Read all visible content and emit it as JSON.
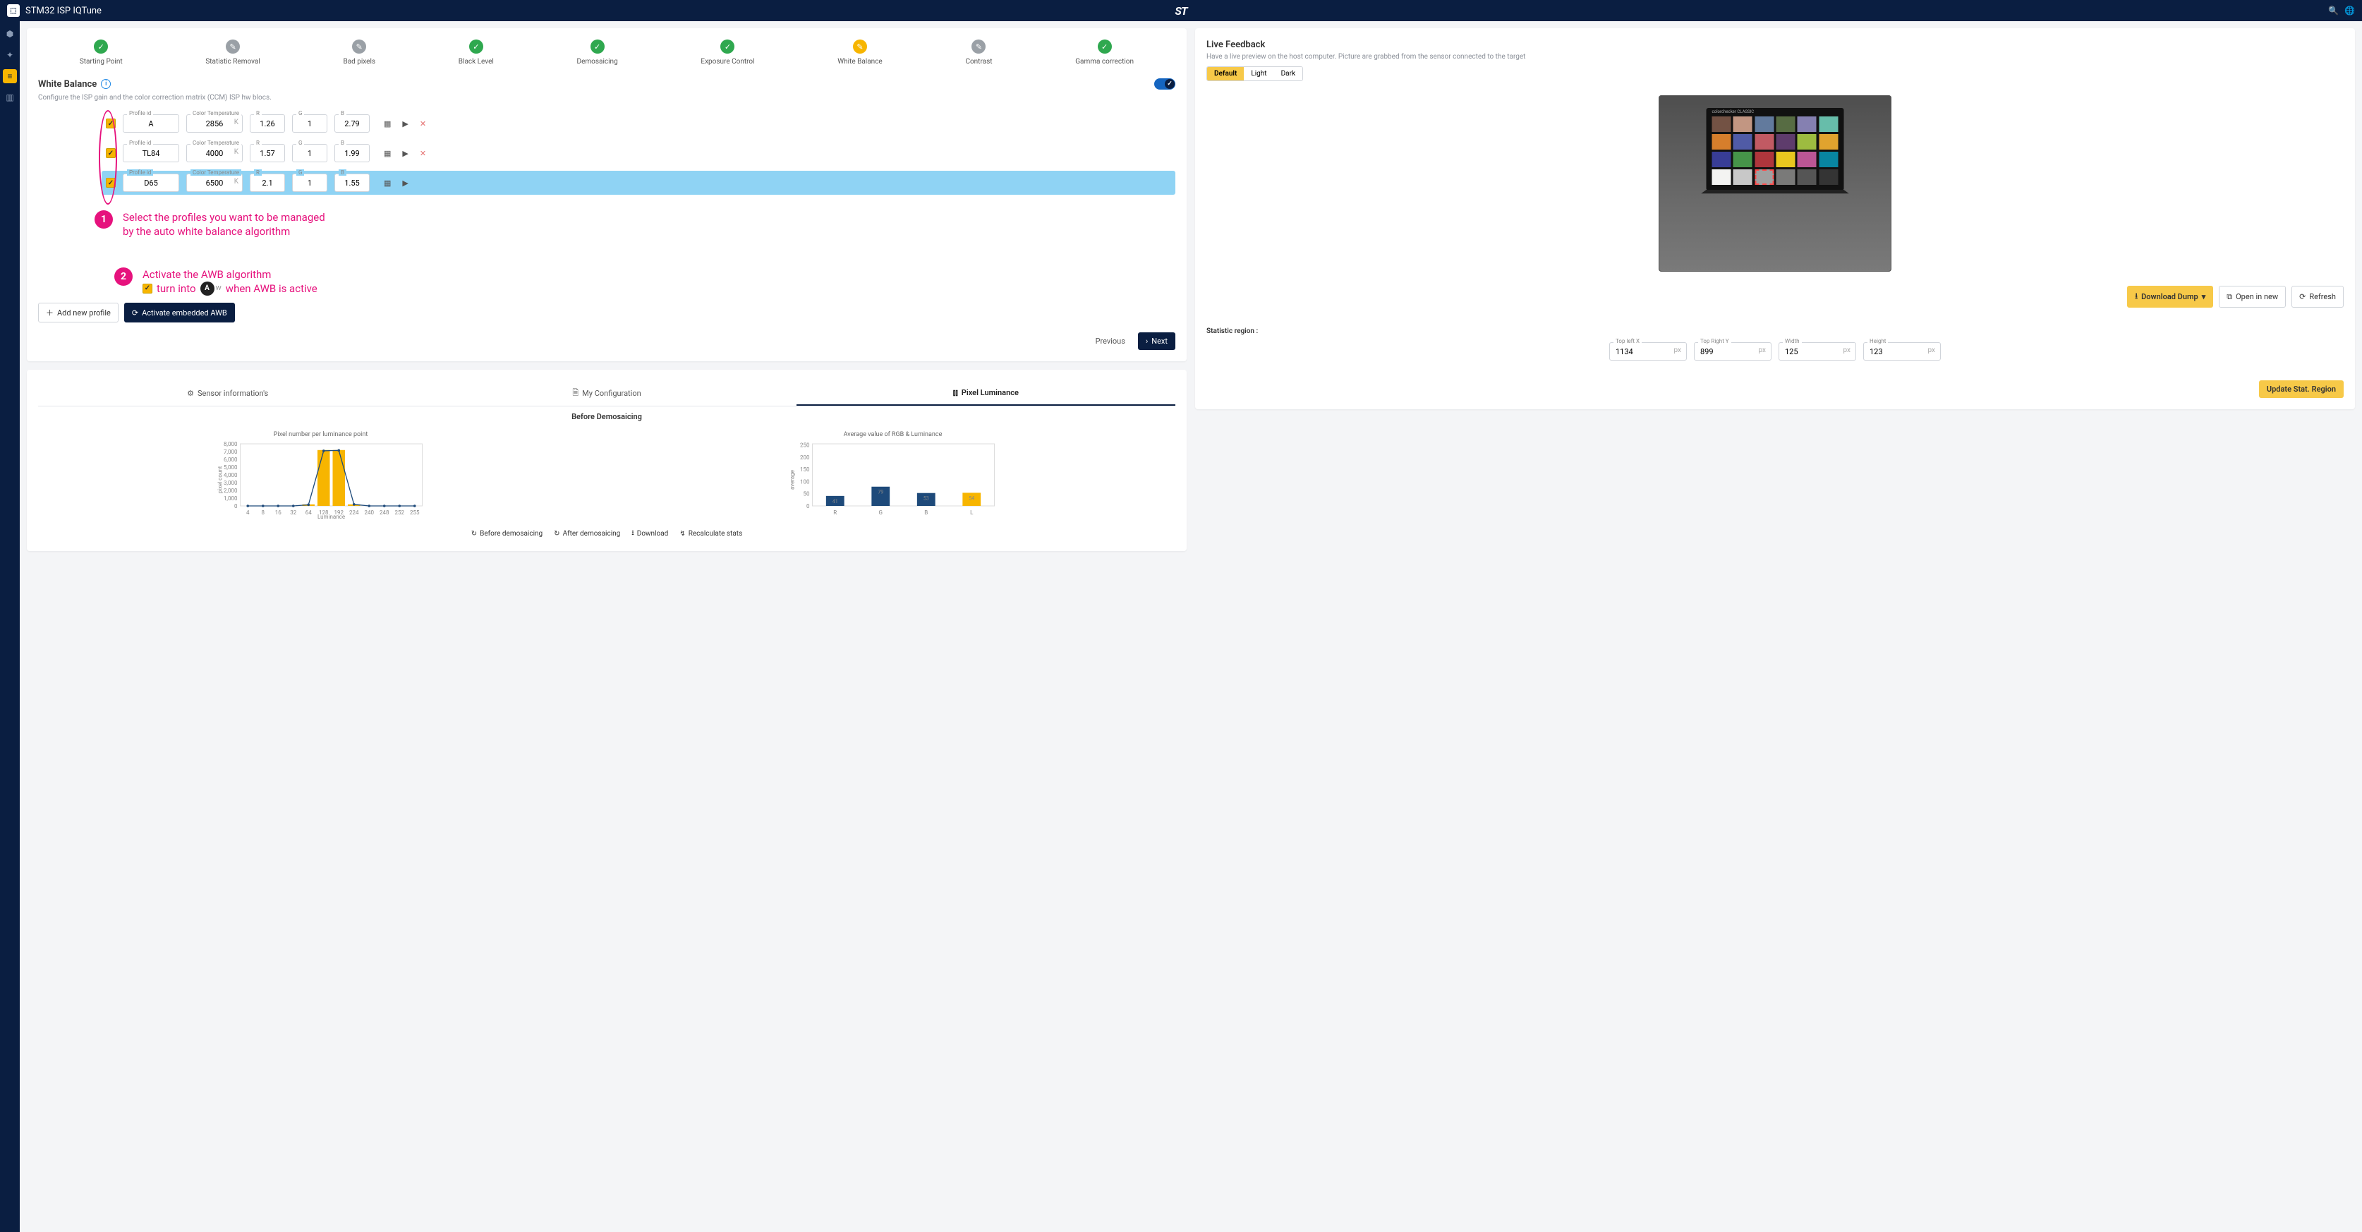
{
  "app_title": "STM32 ISP IQTune",
  "center_logo": "ST",
  "stepper": [
    {
      "label": "Starting Point",
      "state": "green",
      "glyph": "✓"
    },
    {
      "label": "Statistic Removal",
      "state": "gray",
      "glyph": "✎"
    },
    {
      "label": "Bad pixels",
      "state": "gray",
      "glyph": "✎"
    },
    {
      "label": "Black Level",
      "state": "green",
      "glyph": "✓"
    },
    {
      "label": "Demosaicing",
      "state": "green",
      "glyph": "✓"
    },
    {
      "label": "Exposure Control",
      "state": "green",
      "glyph": "✓"
    },
    {
      "label": "White Balance",
      "state": "yellow",
      "glyph": "✎"
    },
    {
      "label": "Contrast",
      "state": "gray",
      "glyph": "✎"
    },
    {
      "label": "Gamma correction",
      "state": "green",
      "glyph": "✓"
    }
  ],
  "wb": {
    "title": "White Balance",
    "subtitle": "Configure the ISP gain and the color correction matrix (CCM) ISP hw blocs.",
    "field_labels": {
      "profile": "Profile id",
      "temp": "Color Temperature",
      "r": "R",
      "g": "G",
      "b": "B"
    },
    "rows": [
      {
        "profile": "A",
        "temp": "2856",
        "r": "1.26",
        "g": "1",
        "b": "2.79",
        "deletable": true,
        "selected": false
      },
      {
        "profile": "TL84",
        "temp": "4000",
        "r": "1.57",
        "g": "1",
        "b": "1.99",
        "deletable": true,
        "selected": false
      },
      {
        "profile": "D65",
        "temp": "6500",
        "r": "2.1",
        "g": "1",
        "b": "1.55",
        "deletable": false,
        "selected": true
      }
    ],
    "add_profile": "Add new profile",
    "activate_awb": "Activate embedded AWB",
    "previous": "Previous",
    "next": "Next"
  },
  "annotations": {
    "a1": "Select the profiles you want to be managed\nby the auto white balance algorithm",
    "a2_line1": "Activate the AWB algorithm",
    "a2_prefix": "turn into",
    "a2_suffix": "when AWB is active"
  },
  "bottom_tabs": {
    "t1": "Sensor information's",
    "t2": "My Configuration",
    "t3": "Pixel Luminance"
  },
  "charts": {
    "main_title": "Before Demosaicing",
    "left_title": "Pixel number per luminance point",
    "right_title": "Average value of RGB & Luminance",
    "y_label_left": "pixel count",
    "y_label_right": "average",
    "x_label_left": "Luminance",
    "actions": {
      "before": "Before demosaicing",
      "after": "After demosaicing",
      "download": "Download",
      "recalc": "Recalculate stats"
    }
  },
  "chart_data": [
    {
      "type": "bar",
      "title": "Pixel number per luminance point",
      "xlabel": "Luminance",
      "ylabel": "pixel count",
      "ylim": [
        0,
        8000
      ],
      "categories": [
        4,
        8,
        16,
        32,
        64,
        128,
        192,
        224,
        240,
        248,
        252,
        255
      ],
      "values": [
        0,
        0,
        0,
        0,
        200,
        7200,
        7200,
        200,
        0,
        0,
        0,
        0
      ],
      "overlay_line": [
        0,
        0,
        0,
        0,
        150,
        7100,
        7150,
        200,
        0,
        0,
        0,
        0
      ]
    },
    {
      "type": "bar",
      "title": "Average value of RGB & Luminance",
      "xlabel": "",
      "ylabel": "average",
      "ylim": [
        0,
        255
      ],
      "categories": [
        "R",
        "G",
        "B",
        "L"
      ],
      "values": [
        41,
        79,
        53,
        54
      ],
      "colors": [
        "#1e4a7a",
        "#1e4a7a",
        "#1e4a7a",
        "#f7b500"
      ]
    }
  ],
  "feedback": {
    "title": "Live Feedback",
    "subtitle": "Have a live preview on the host computer. Picture are grabbed from the sensor connected to the target",
    "seg": [
      "Default",
      "Light",
      "Dark"
    ],
    "download_dump": "Download Dump",
    "open_new": "Open in new",
    "refresh": "Refresh",
    "stat_label": "Statistic region :",
    "fields": {
      "tlx": {
        "label": "Top left X",
        "value": "1134",
        "unit": "px"
      },
      "try": {
        "label": "Top Right Y",
        "value": "899",
        "unit": "px"
      },
      "w": {
        "label": "Width",
        "value": "125",
        "unit": "px"
      },
      "h": {
        "label": "Height",
        "value": "123",
        "unit": "px"
      }
    },
    "update": "Update Stat. Region",
    "colorchecker_label": "colorchecker CLASSIC",
    "colorchecker": [
      "#735244",
      "#c29682",
      "#627a9d",
      "#576c43",
      "#8580b1",
      "#67bdaa",
      "#d67e2c",
      "#505ba6",
      "#c15a63",
      "#5e3c6c",
      "#9dbc40",
      "#e0a32e",
      "#383d96",
      "#469449",
      "#af363c",
      "#e7c71f",
      "#bb5695",
      "#0885a1",
      "#f3f3f2",
      "#c8c8c8",
      "#a0a0a0",
      "#7a7a79",
      "#555555",
      "#343434"
    ],
    "patch_highlight_index": 20
  }
}
